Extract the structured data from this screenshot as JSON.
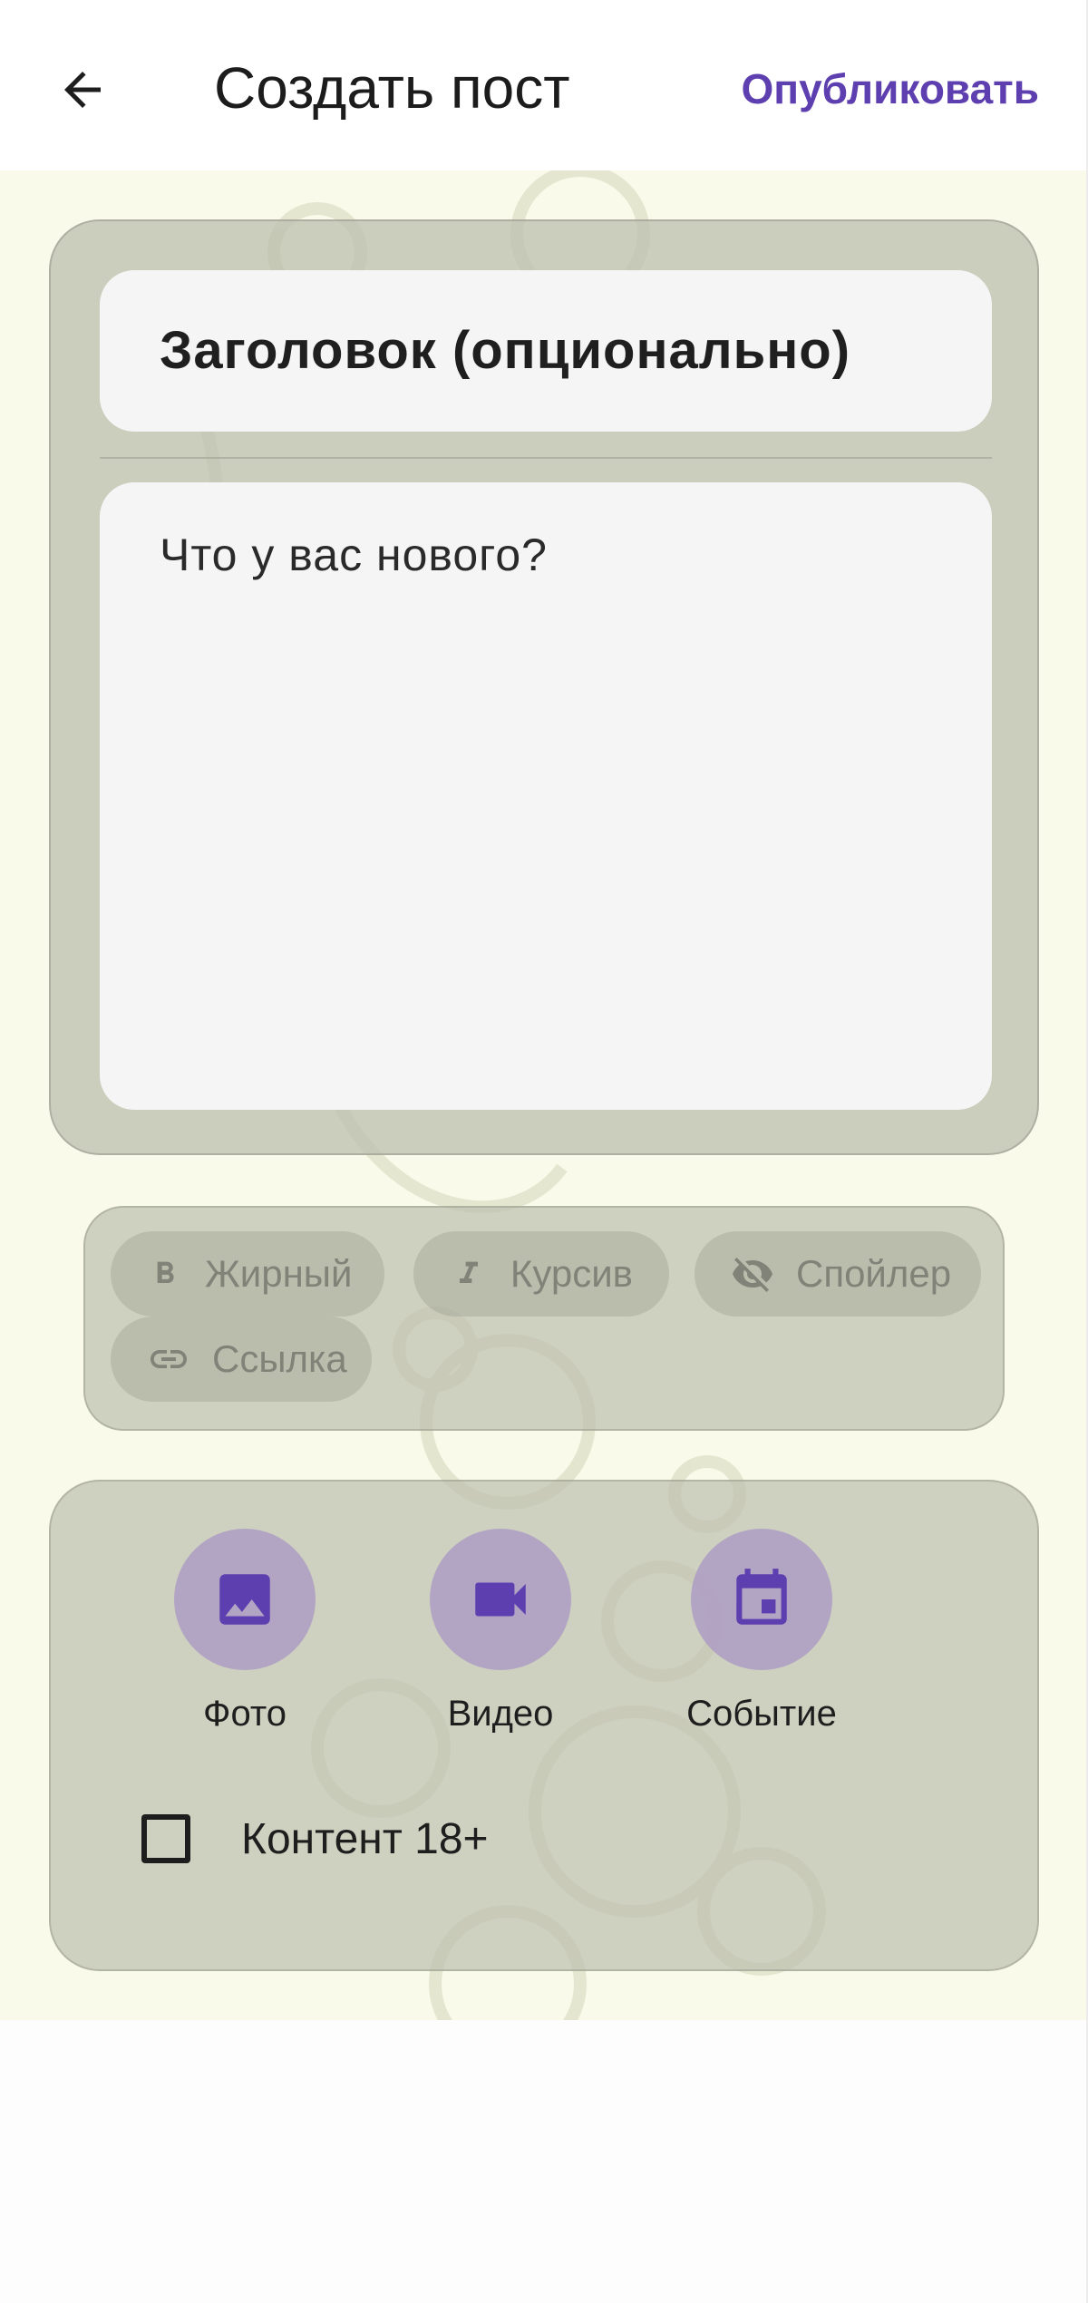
{
  "header": {
    "back_icon": "arrow-back-icon",
    "title": "Создать пост",
    "publish_label": "Опубликовать"
  },
  "editor": {
    "title_placeholder": "Заголовок (опционально)",
    "body_placeholder": "Что у вас нового?"
  },
  "formatting": {
    "bold": {
      "label": "Жирный",
      "icon": "bold-icon",
      "glyph": "B"
    },
    "italic": {
      "label": "Курсив",
      "icon": "italic-icon",
      "glyph": "I"
    },
    "spoiler": {
      "label": "Спойлер",
      "icon": "eye-off-icon"
    },
    "link": {
      "label": "Ссылка",
      "icon": "link-icon"
    }
  },
  "attachments": {
    "photo": {
      "label": "Фото",
      "icon": "image-icon"
    },
    "video": {
      "label": "Видео",
      "icon": "videocam-icon"
    },
    "event": {
      "label": "Событие",
      "icon": "calendar-icon"
    }
  },
  "nsfw": {
    "label": "Контент 18+",
    "checked": false
  },
  "colors": {
    "accent": "#5e3fb0",
    "background": "#f9faea",
    "card": "#bec0b0",
    "input": "#f5f5f5"
  }
}
